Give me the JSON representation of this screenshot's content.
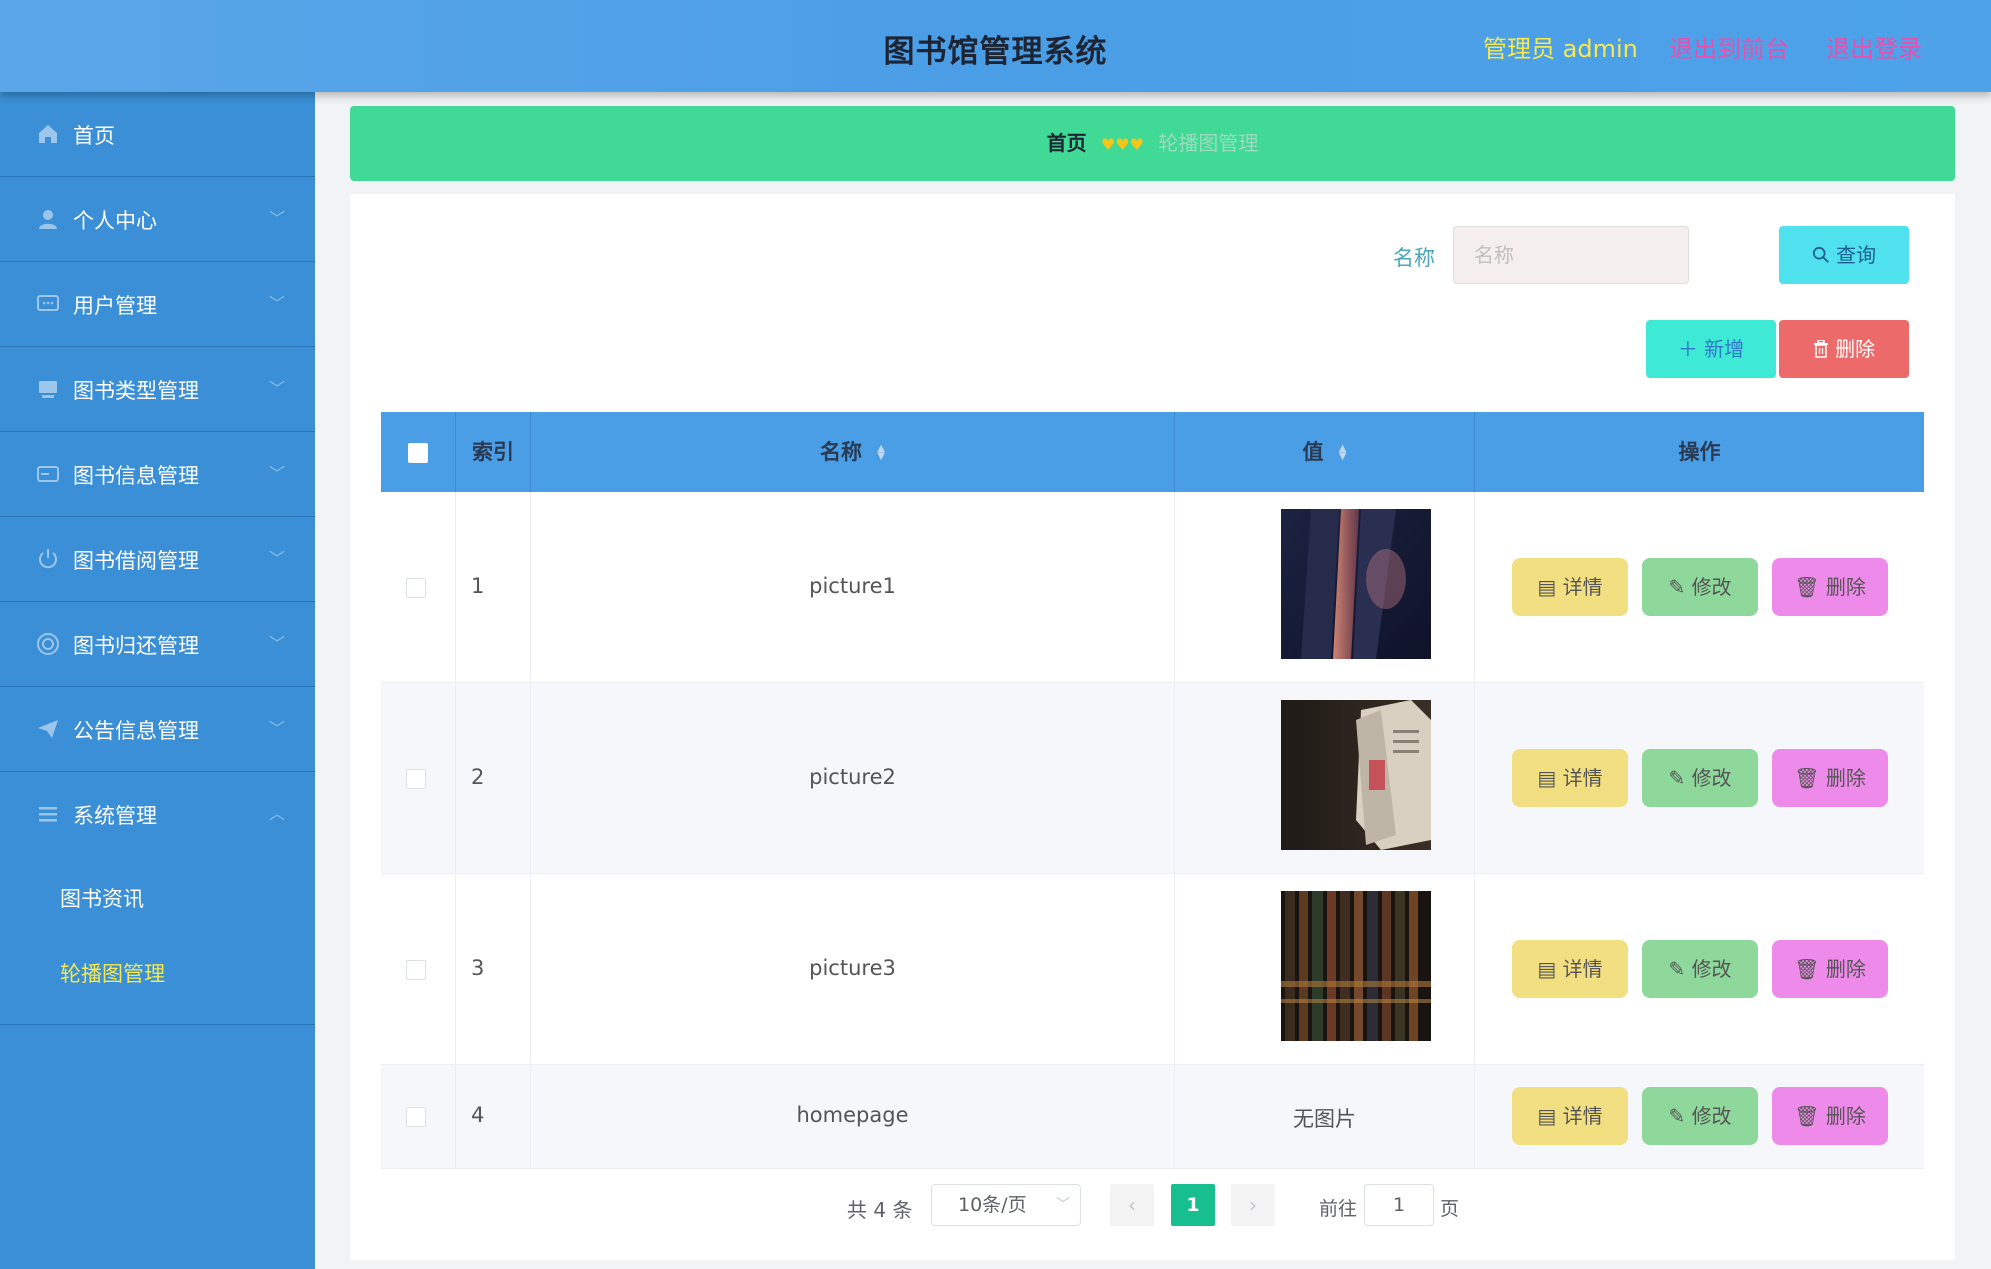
{
  "header": {
    "title": "图书馆管理系统",
    "admin_label": "管理员 admin",
    "front_label": "退出到前台",
    "logout_label": "退出登录"
  },
  "sidebar": {
    "items": [
      {
        "label": "首页",
        "icon": "home-icon"
      },
      {
        "label": "个人中心",
        "icon": "user-icon"
      },
      {
        "label": "用户管理",
        "icon": "chat-icon"
      },
      {
        "label": "图书类型管理",
        "icon": "monitor-icon"
      },
      {
        "label": "图书信息管理",
        "icon": "card-icon"
      },
      {
        "label": "图书借阅管理",
        "icon": "power-icon"
      },
      {
        "label": "图书归还管理",
        "icon": "target-icon"
      },
      {
        "label": "公告信息管理",
        "icon": "send-icon"
      },
      {
        "label": "系统管理",
        "icon": "menu-icon"
      }
    ],
    "sub_items": [
      {
        "label": "图书资讯",
        "active": false
      },
      {
        "label": "轮播图管理",
        "active": true
      }
    ]
  },
  "breadcrumb": {
    "home": "首页",
    "separator": "♥♥♥",
    "current": "轮播图管理"
  },
  "search": {
    "label": "名称",
    "placeholder": "名称",
    "button_label": "查询"
  },
  "actions": {
    "add_label": "新增",
    "delete_label": "删除"
  },
  "table": {
    "headers": {
      "index": "索引",
      "name": "名称",
      "value": "值",
      "ops": "操作"
    },
    "rows": [
      {
        "index": "1",
        "name": "picture1",
        "value": "",
        "has_image": true,
        "image": "book-pages"
      },
      {
        "index": "2",
        "name": "picture2",
        "value": "",
        "has_image": true,
        "image": "open-book"
      },
      {
        "index": "3",
        "name": "picture3",
        "value": "",
        "has_image": true,
        "image": "bookshelf"
      },
      {
        "index": "4",
        "name": "homepage",
        "value": "无图片",
        "has_image": false
      }
    ],
    "row_actions": {
      "detail": "详情",
      "edit": "修改",
      "delete": "删除"
    }
  },
  "pagination": {
    "total_text": "共 4 条",
    "page_size": "10条/页",
    "current_page": "1",
    "goto_label": "前往",
    "goto_value": "1",
    "page_suffix": "页"
  },
  "colors": {
    "header_bg": "#4a9ee6",
    "sidebar_bg": "#3a8fd6",
    "breadcrumb_bg": "#41d996",
    "accent_green": "#17be8e"
  }
}
